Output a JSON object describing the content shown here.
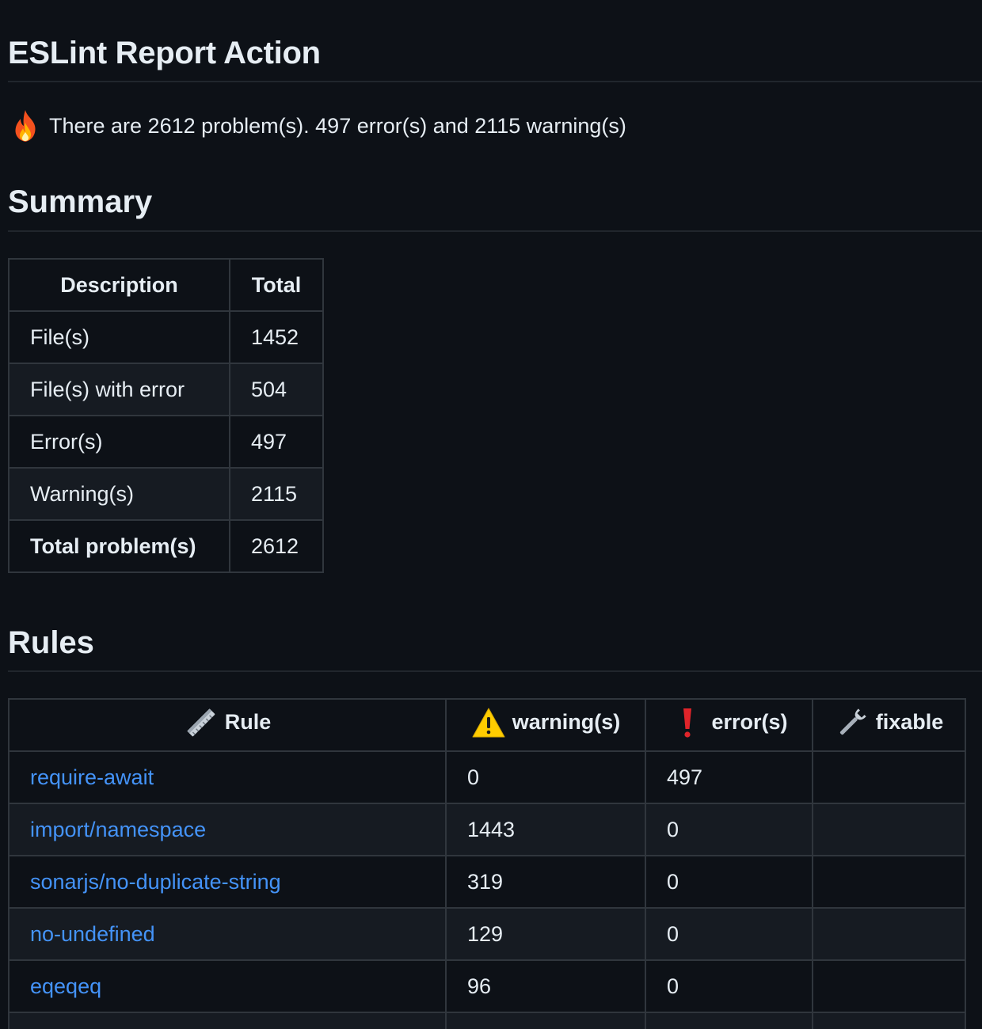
{
  "header": {
    "title": "ESLint Report Action",
    "summary_text": "There are 2612 problem(s). 497 error(s) and 2115 warning(s)"
  },
  "summary": {
    "title": "Summary",
    "columns": [
      "Description",
      "Total"
    ],
    "rows": [
      {
        "description": "File(s)",
        "total": "1452"
      },
      {
        "description": "File(s) with error",
        "total": "504"
      },
      {
        "description": "Error(s)",
        "total": "497"
      },
      {
        "description": "Warning(s)",
        "total": "2115"
      },
      {
        "description": "Total problem(s)",
        "total": "2612"
      }
    ]
  },
  "rules": {
    "title": "Rules",
    "columns": {
      "rule": "Rule",
      "warnings": "warning(s)",
      "errors": "error(s)",
      "fixable": "fixable"
    },
    "rows": [
      {
        "rule": "require-await",
        "warnings": "0",
        "errors": "497",
        "fixable": ""
      },
      {
        "rule": "import/namespace",
        "warnings": "1443",
        "errors": "0",
        "fixable": ""
      },
      {
        "rule": "sonarjs/no-duplicate-string",
        "warnings": "319",
        "errors": "0",
        "fixable": ""
      },
      {
        "rule": "no-undefined",
        "warnings": "129",
        "errors": "0",
        "fixable": ""
      },
      {
        "rule": "eqeqeq",
        "warnings": "96",
        "errors": "0",
        "fixable": ""
      }
    ]
  },
  "icons": {
    "summary": "fire-icon",
    "rule": "ruler-icon",
    "warnings": "warning-icon",
    "errors": "exclamation-icon",
    "fixable": "wrench-icon"
  },
  "colors": {
    "background": "#0d1117",
    "text": "#e6edf3",
    "link": "#4493f8",
    "border": "#30363d",
    "row_alt": "#161b22"
  }
}
